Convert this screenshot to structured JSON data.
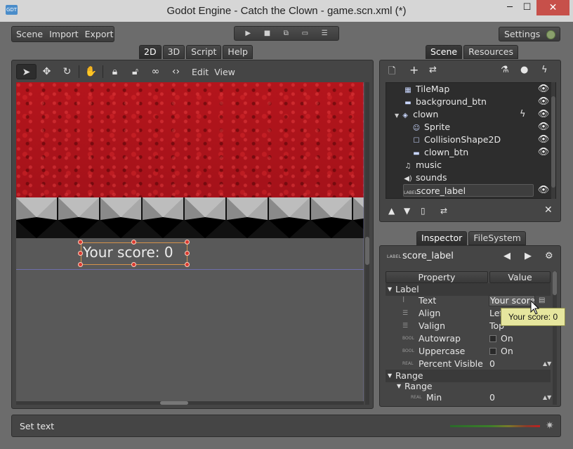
{
  "window": {
    "title": "Godot Engine - Catch the Clown - game.scn.xml (*)",
    "app_icon": "godot-logo-icon",
    "controls": {
      "minimize": "─",
      "maximize": "☐",
      "close": "✕"
    }
  },
  "menu": {
    "items": [
      "Scene",
      "Import",
      "Export"
    ]
  },
  "playbar": {
    "icons": [
      "play-icon",
      "stop-icon",
      "play-scene-icon",
      "open-folder-icon",
      "menu-icon"
    ]
  },
  "settings": {
    "label": "Settings"
  },
  "main_tabs": [
    "2D",
    "3D",
    "Script",
    "Help"
  ],
  "editor_toolbar": {
    "edit": "Edit",
    "view": "View"
  },
  "viewport": {
    "label_text": "Your score: 0",
    "colors": {
      "background_red": "#b4151c",
      "selection": "#d4924a"
    }
  },
  "dock_tabs_top": [
    "Scene",
    "Resources"
  ],
  "scene_tree": {
    "nodes": [
      {
        "name": "TileMap",
        "icon": "tilemap-icon"
      },
      {
        "name": "background_btn",
        "icon": "button-icon"
      },
      {
        "name": "clown",
        "icon": "kinematic-body-icon",
        "expanded": true
      },
      {
        "name": "Sprite",
        "icon": "sprite-icon"
      },
      {
        "name": "CollisionShape2D",
        "icon": "collision-shape-icon"
      },
      {
        "name": "clown_btn",
        "icon": "button-icon"
      },
      {
        "name": "music",
        "icon": "music-icon"
      },
      {
        "name": "sounds",
        "icon": "speaker-icon"
      },
      {
        "name": "score_label",
        "icon": "label-icon",
        "selected": true
      }
    ]
  },
  "dock_tabs_mid": [
    "Inspector",
    "FileSystem"
  ],
  "inspector": {
    "node_type_badge": "LABEL",
    "node_name": "score_label",
    "columns": [
      "Property",
      "Value"
    ],
    "section_label": "Label",
    "props": [
      {
        "type": "",
        "name": "Text",
        "value": "Your score"
      },
      {
        "type": "",
        "name": "Align",
        "value": "Left"
      },
      {
        "type": "",
        "name": "Valign",
        "value": "Top"
      },
      {
        "type": "BOOL",
        "name": "Autowrap",
        "value": "On"
      },
      {
        "type": "BOOL",
        "name": "Uppercase",
        "value": "On"
      },
      {
        "type": "REAL",
        "name": "Percent Visible",
        "value": "0"
      }
    ],
    "section_range": "Range",
    "subsection_range": "Range",
    "min_prop": {
      "type": "REAL",
      "name": "Min",
      "value": "0"
    }
  },
  "tooltip": "Your score: 0",
  "status": {
    "message": "Set text"
  }
}
